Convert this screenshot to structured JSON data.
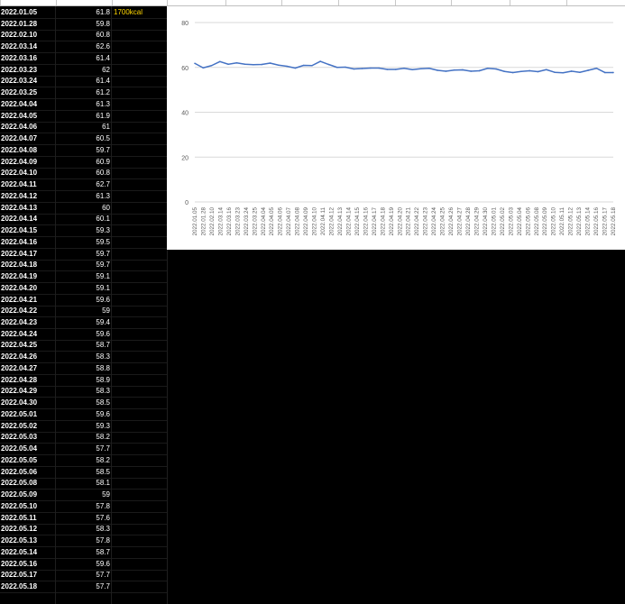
{
  "note": "1700kcal",
  "colors": {
    "series": "#4472c4",
    "grid": "#d9d9d9",
    "axis_text": "#595959"
  },
  "chart_data": {
    "type": "line",
    "title": "",
    "xlabel": "",
    "ylabel": "",
    "ylim": [
      0,
      80
    ],
    "yticks": [
      0,
      20,
      40,
      60,
      80
    ],
    "grid": true,
    "legend": "none",
    "x": [
      "2022.01.05",
      "2022.01.28",
      "2022.02.10",
      "2022.03.14",
      "2022.03.16",
      "2022.03.23",
      "2022.03.24",
      "2022.03.25",
      "2022.04.04",
      "2022.04.05",
      "2022.04.06",
      "2022.04.07",
      "2022.04.08",
      "2022.04.09",
      "2022.04.10",
      "2022.04.11",
      "2022.04.12",
      "2022.04.13",
      "2022.04.14",
      "2022.04.15",
      "2022.04.16",
      "2022.04.17",
      "2022.04.18",
      "2022.04.19",
      "2022.04.20",
      "2022.04.21",
      "2022.04.22",
      "2022.04.23",
      "2022.04.24",
      "2022.04.25",
      "2022.04.26",
      "2022.04.27",
      "2022.04.28",
      "2022.04.29",
      "2022.04.30",
      "2022.05.01",
      "2022.05.02",
      "2022.05.03",
      "2022.05.04",
      "2022.05.05",
      "2022.05.06",
      "2022.05.08",
      "2022.05.09",
      "2022.05.10",
      "2022.05.11",
      "2022.05.12",
      "2022.05.13",
      "2022.05.14",
      "2022.05.16",
      "2022.05.17",
      "2022.05.18"
    ],
    "values": [
      "61.8",
      "59.8",
      "60.8",
      "62.6",
      "61.4",
      "62",
      "61.4",
      "61.2",
      "61.3",
      "61.9",
      "61",
      "60.5",
      "59.7",
      "60.9",
      "60.8",
      "62.7",
      "61.3",
      "60",
      "60.1",
      "59.3",
      "59.5",
      "59.7",
      "59.7",
      "59.1",
      "59.1",
      "59.6",
      "59",
      "59.4",
      "59.6",
      "58.7",
      "58.3",
      "58.8",
      "58.9",
      "58.3",
      "58.5",
      "59.6",
      "59.3",
      "58.2",
      "57.7",
      "58.2",
      "58.5",
      "58.1",
      "59",
      "57.8",
      "57.6",
      "58.3",
      "57.8",
      "58.7",
      "59.6",
      "57.7",
      "57.7"
    ],
    "x_tick_labels": [
      "2022.01.05",
      "2022.01.28",
      "2022.02.10",
      "2022.03.14",
      "2022.03.16",
      "2022.03.23",
      "2022.03.24",
      "2022.03.25",
      "2022.04.04",
      "2022.04.05",
      "2022.04.06",
      "2022.04.07",
      "2022.04.08",
      "2022.04.09",
      "2022.04.10",
      "2022.04.11",
      "2022.04.12",
      "2022.04.13",
      "2022.04.14",
      "2022.04.15",
      "2022.04.16",
      "2022.04.17",
      "2022.04.18",
      "2022.04.19",
      "2022.04.20",
      "2022.04.21",
      "2022.04.22",
      "2022.04.23",
      "2022.04.24",
      "2022.04.25",
      "2022.04.26",
      "2022.04.27",
      "2022.04.28",
      "2022.04.29",
      "2022.04.30",
      "2022.05.01",
      "2022.05.02",
      "2022.05.03",
      "2022.05.04",
      "2022.05.06",
      "2022.05.08",
      "2022.05.09",
      "2022.05.10",
      "2022.05.11",
      "2022.05.12",
      "2022.05.13",
      "2022.05.14",
      "2022.05.16",
      "2022.05.17",
      "2022.05.18"
    ]
  }
}
